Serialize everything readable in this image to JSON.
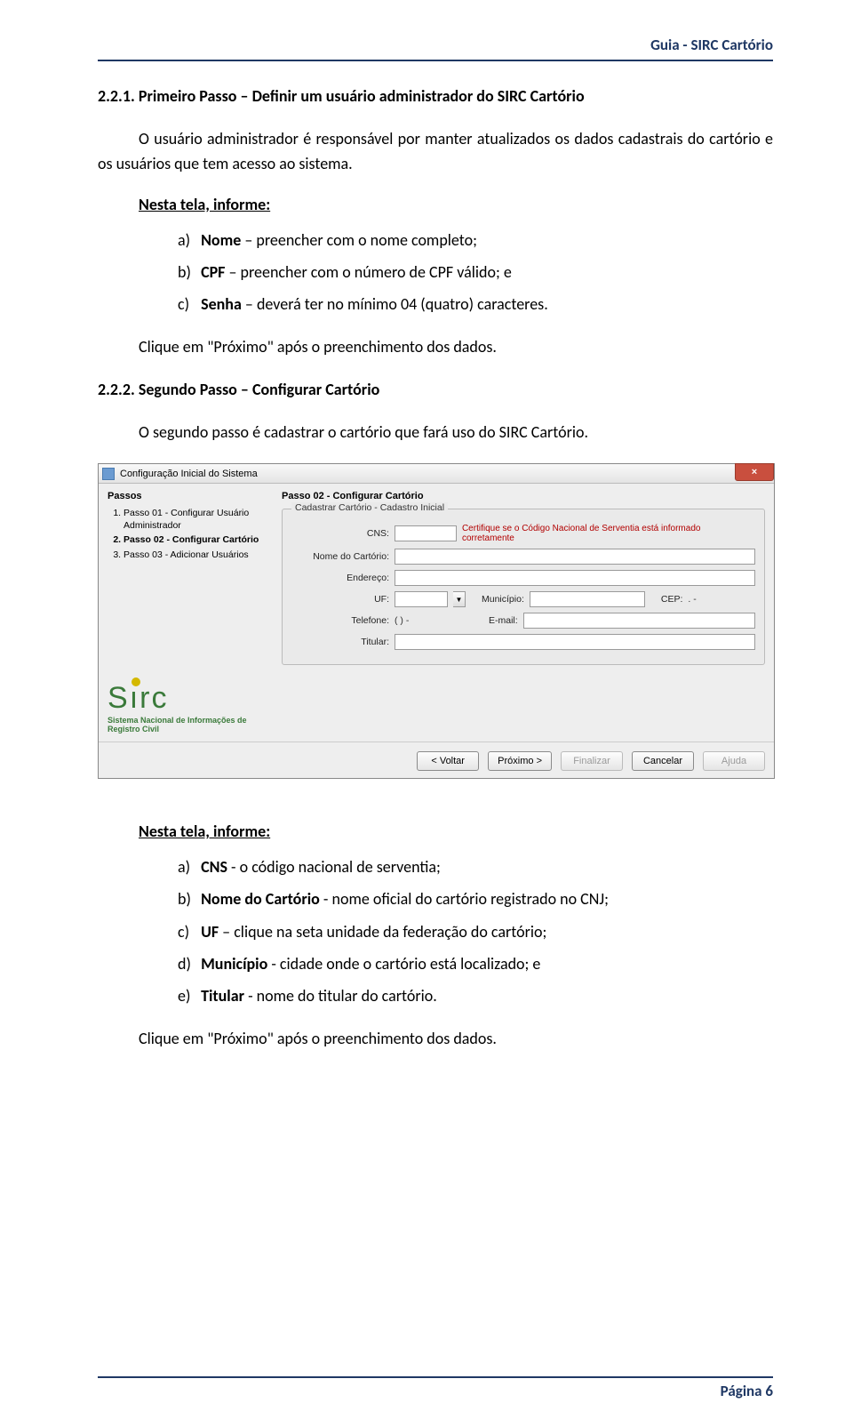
{
  "header": {
    "title": "Guia - SIRC Cartório"
  },
  "section1": {
    "num_title": "2.2.1. Primeiro Passo – Definir um usuário administrador do SIRC Cartório",
    "para": "O usuário administrador é responsável por manter atualizados os dados cadastrais do cartório e os usuários que tem acesso ao sistema.",
    "list_intro": "Nesta tela, informe:",
    "items": {
      "a": {
        "lbl": "a)",
        "bold": "Nome",
        "rest": " – preencher com o nome completo;"
      },
      "b": {
        "lbl": "b)",
        "bold": "CPF",
        "rest": " – preencher com o número de CPF válido; e"
      },
      "c": {
        "lbl": "c)",
        "bold": "Senha",
        "rest": " – deverá ter no mínimo 04 (quatro) caracteres."
      }
    },
    "post": "Clique em \"Próximo\" após o preenchimento dos dados."
  },
  "section2": {
    "num_title": "2.2.2. Segundo Passo – Configurar Cartório",
    "para": "O segundo passo é cadastrar o cartório que fará uso do SIRC Cartório."
  },
  "window": {
    "title": "Configuração Inicial do Sistema",
    "close": "×",
    "passos_title": "Passos",
    "steps": {
      "s1": "Passo 01 - Configurar Usuário Administrador",
      "s2": "Passo 02 - Configurar Cartório",
      "s3": "Passo 03 - Adicionar Usuários"
    },
    "logo_text": "Sırc",
    "logo_sub": "Sistema Nacional de Informações de Registro Civil",
    "step_title": "Passo 02 - Configurar Cartório",
    "panel_legend": "Cadastrar Cartório - Cadastro Inicial",
    "labels": {
      "cns": "CNS:",
      "nome": "Nome do Cartório:",
      "endereco": "Endereço:",
      "uf": "UF:",
      "municipio": "Município:",
      "cep": "CEP:",
      "telefone": "Telefone:",
      "email": "E-mail:",
      "titular": "Titular:"
    },
    "hint": "Certifique se o Código Nacional de Serventia está informado corretamente",
    "tel_mask": "(  )   -",
    "cep_mask": " .   -",
    "buttons": {
      "voltar": "< Voltar",
      "proximo": "Próximo >",
      "finalizar": "Finalizar",
      "cancelar": "Cancelar",
      "ajuda": "Ajuda"
    }
  },
  "section3": {
    "list_intro": "Nesta tela, informe:",
    "items": {
      "a": {
        "lbl": "a)",
        "bold": "CNS",
        "rest": " - o código nacional de serventia;"
      },
      "b": {
        "lbl": "b)",
        "bold": "Nome do Cartório",
        "rest": " - nome oficial do cartório registrado no CNJ;"
      },
      "c": {
        "lbl": "c)",
        "bold": "UF",
        "rest": " – clique na seta unidade da federação do cartório;"
      },
      "d": {
        "lbl": "d)",
        "bold": "Município",
        "rest": " - cidade onde o cartório está localizado; e"
      },
      "e": {
        "lbl": "e)",
        "bold": "Titular",
        "rest": " - nome do titular do cartório."
      }
    },
    "post": "Clique em \"Próximo\" após o preenchimento dos dados."
  },
  "footer": {
    "text": "Página 6"
  }
}
